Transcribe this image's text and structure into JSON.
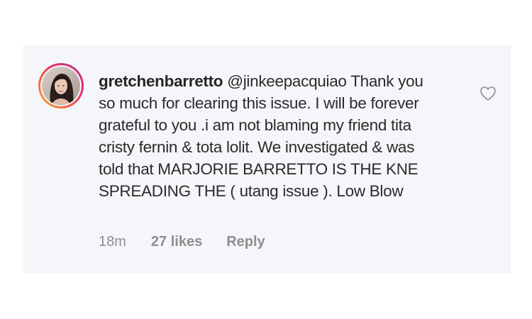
{
  "comment": {
    "username": "gretchenbarretto",
    "lines": [
      "@jinkeepacquiao Thank you",
      "so much for clearing this issue. I will be forever",
      "grateful to you .i am not blaming my friend tita",
      "cristy fernin & tota lolit. We investigated & was",
      "told that MARJORIE BARRETTO IS THE KNE",
      "SPREADING THE ( utang issue ). Low Blow"
    ],
    "time": "18m",
    "likes": "27 likes",
    "reply_label": "Reply"
  },
  "icons": {
    "like": "heart-outline-icon",
    "avatar": "profile-photo"
  },
  "colors": {
    "card_background": "#f4f6f9",
    "text": "#262626",
    "meta": "#8e8e8e",
    "story_ring": [
      "#f7b733",
      "#f56040",
      "#e1306c",
      "#c13584"
    ]
  }
}
